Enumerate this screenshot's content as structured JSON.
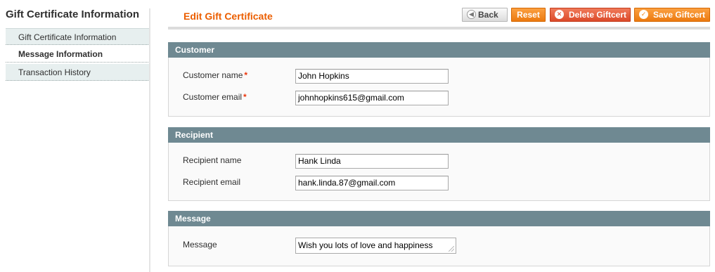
{
  "sidebar": {
    "title": "Gift Certificate Information",
    "tabs": [
      {
        "label": "Gift Certificate Information"
      },
      {
        "label": "Message Information"
      },
      {
        "label": "Transaction History"
      }
    ]
  },
  "header": {
    "title": "Edit Gift Certificate",
    "buttons": {
      "back": "Back",
      "reset": "Reset",
      "delete": "Delete Giftcert",
      "save": "Save Giftcert"
    }
  },
  "sections": {
    "customer": {
      "title": "Customer",
      "name_label": "Customer name",
      "name_value": "John Hopkins",
      "email_label": "Customer email",
      "email_value": "johnhopkins615@gmail.com",
      "required_mark": "*"
    },
    "recipient": {
      "title": "Recipient",
      "name_label": "Recipient name",
      "name_value": "Hank Linda",
      "email_label": "Recipient email",
      "email_value": "hank.linda.87@gmail.com"
    },
    "message": {
      "title": "Message",
      "label": "Message",
      "value": "Wish you lots of love and happiness"
    }
  },
  "colors": {
    "accent": "#eb5e00",
    "section_header": "#6f8992",
    "required": "#eb340a"
  },
  "icons": {
    "back": "arrow-left-icon",
    "delete": "delete-circle-icon",
    "save": "check-circle-icon"
  }
}
